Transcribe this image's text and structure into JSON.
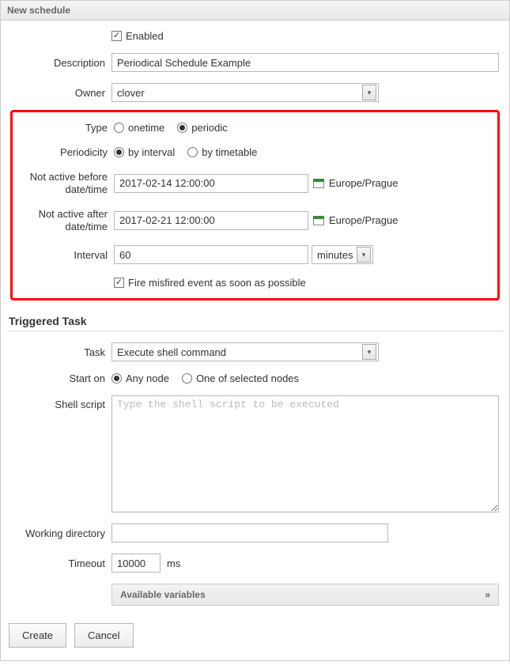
{
  "header": {
    "title": "New schedule"
  },
  "fields": {
    "enabled": {
      "label": "Enabled",
      "checked": true
    },
    "description": {
      "label": "Description",
      "value": "Periodical Schedule Example"
    },
    "owner": {
      "label": "Owner",
      "value": "clover"
    },
    "type": {
      "label": "Type",
      "options": {
        "onetime": "onetime",
        "periodic": "periodic"
      },
      "selected": "periodic"
    },
    "periodicity": {
      "label": "Periodicity",
      "options": {
        "interval": "by interval",
        "timetable": "by timetable"
      },
      "selected": "interval"
    },
    "not_active_before": {
      "label1": "Not active before",
      "label2": "date/time",
      "value": "2017-02-14 12:00:00",
      "tz": "Europe/Prague"
    },
    "not_active_after": {
      "label1": "Not active after",
      "label2": "date/time",
      "value": "2017-02-21 12:00:00",
      "tz": "Europe/Prague"
    },
    "interval": {
      "label": "Interval",
      "value": "60",
      "unit": "minutes"
    },
    "fire_misfired": {
      "label": "Fire misfired event as soon as possible",
      "checked": true
    }
  },
  "triggered": {
    "title": "Triggered Task",
    "task": {
      "label": "Task",
      "value": "Execute shell command"
    },
    "start_on": {
      "label": "Start on",
      "options": {
        "any": "Any node",
        "selected": "One of selected nodes"
      },
      "selected": "any"
    },
    "shell": {
      "label": "Shell script",
      "placeholder": "Type the shell script to be executed",
      "value": ""
    },
    "workdir": {
      "label": "Working directory",
      "value": ""
    },
    "timeout": {
      "label": "Timeout",
      "value": "10000",
      "unit": "ms"
    },
    "vars": {
      "label": "Available variables",
      "expand": "»"
    }
  },
  "buttons": {
    "create": "Create",
    "cancel": "Cancel"
  }
}
